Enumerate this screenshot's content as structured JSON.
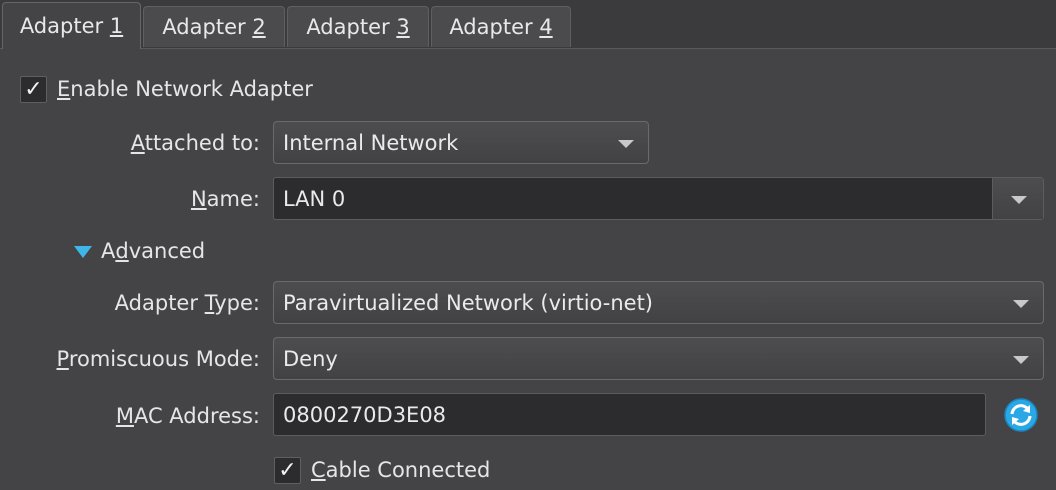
{
  "tabs": [
    {
      "prefix": "Adapter ",
      "mnemonic": "1",
      "active": true
    },
    {
      "prefix": "Adapter ",
      "mnemonic": "2",
      "active": false
    },
    {
      "prefix": "Adapter ",
      "mnemonic": "3",
      "active": false
    },
    {
      "prefix": "Adapter ",
      "mnemonic": "4",
      "active": false
    }
  ],
  "enable_adapter": {
    "checked": true,
    "mnemonic": "E",
    "rest": "nable Network Adapter"
  },
  "attached_to": {
    "mnemonic": "A",
    "rest": "ttached to:",
    "value": "Internal Network"
  },
  "name": {
    "mnemonic": "N",
    "rest": "ame:",
    "value": "LAN 0"
  },
  "advanced": {
    "pre": "A",
    "mnemonic": "d",
    "rest": "vanced",
    "expanded": true
  },
  "adapter_type": {
    "pre": "Adapter ",
    "mnemonic": "T",
    "rest": "ype:",
    "value": "Paravirtualized Network (virtio-net)"
  },
  "promiscuous_mode": {
    "mnemonic": "P",
    "rest": "romiscuous Mode:",
    "value": "Deny"
  },
  "mac_address": {
    "mnemonic": "M",
    "rest": "AC Address:",
    "value": "0800270D3E08"
  },
  "cable_connected": {
    "checked": true,
    "mnemonic": "C",
    "rest": "able Connected"
  },
  "colors": {
    "background": "#444446",
    "refresh_icon": "#2aa8e6",
    "expander": "#3fb6ea"
  }
}
